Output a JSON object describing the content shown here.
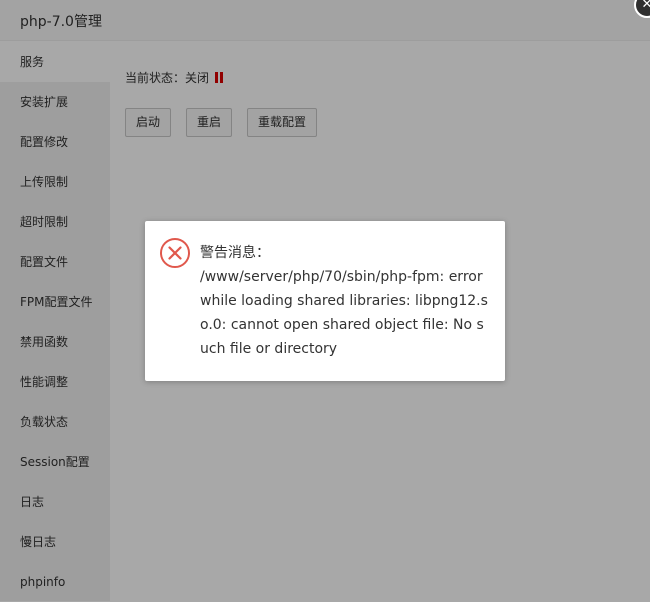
{
  "window": {
    "title": "php-7.0管理",
    "close_glyph": "✕"
  },
  "sidebar": {
    "items": [
      {
        "label": "服务",
        "active": true
      },
      {
        "label": "安装扩展"
      },
      {
        "label": "配置修改"
      },
      {
        "label": "上传限制"
      },
      {
        "label": "超时限制"
      },
      {
        "label": "配置文件"
      },
      {
        "label": "FPM配置文件"
      },
      {
        "label": "禁用函数"
      },
      {
        "label": "性能调整"
      },
      {
        "label": "负载状态"
      },
      {
        "label": "Session配置"
      },
      {
        "label": "日志"
      },
      {
        "label": "慢日志"
      },
      {
        "label": "phpinfo"
      }
    ]
  },
  "service": {
    "status_label": "当前状态：关闭",
    "status_icon": "pause-icon",
    "status_color": "#dd0000",
    "buttons": {
      "start": "启动",
      "restart": "重启",
      "reload": "重载配置"
    }
  },
  "dialog": {
    "icon": "error-icon",
    "icon_color": "#e0584c",
    "title": "警告消息：",
    "message": "/www/server/php/70/sbin/php-fpm: error while loading shared libraries: libpng12.so.0: cannot open shared object file: No such file or directory"
  }
}
